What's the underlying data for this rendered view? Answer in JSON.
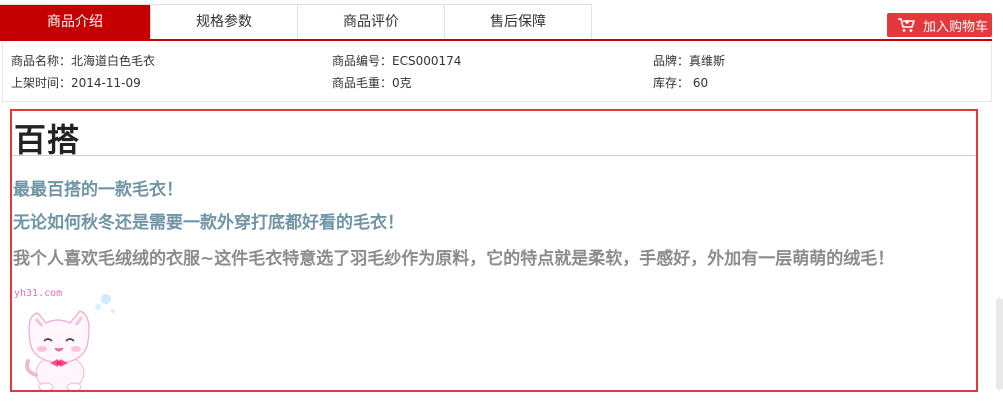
{
  "tabs": [
    {
      "label": "商品介绍",
      "active": true
    },
    {
      "label": "规格参数",
      "active": false
    },
    {
      "label": "商品评价",
      "active": false
    },
    {
      "label": "售后保障",
      "active": false
    }
  ],
  "cart_button": {
    "label": "加入购物车",
    "icon": "cart-icon"
  },
  "attributes": {
    "name": {
      "key": "商品名称：",
      "value": "北海道白色毛衣"
    },
    "sku": {
      "key": "商品编号：",
      "value": "ECS000174"
    },
    "brand": {
      "key": "品牌：",
      "value": "真维斯"
    },
    "date": {
      "key": "上架时间：",
      "value": "2014-11-09"
    },
    "weight": {
      "key": "商品毛重：",
      "value": "0克"
    },
    "stock": {
      "key": "库存：",
      "value": " 60"
    }
  },
  "description": {
    "title": "百搭",
    "line1": "最最百搭的一款毛衣！",
    "line2": "无论如何秋冬还是需要一款外穿打底都好看的毛衣！",
    "line3": "我个人喜欢毛绒绒的衣服~这件毛衣特意选了羽毛纱作为原料，它的特点就是柔软，手感好，外加有一层萌萌的绒毛！",
    "watermark": "yh31.com"
  },
  "colors": {
    "accent": "#c40000",
    "cart": "#e4393c",
    "highlight_border": "#e4393c",
    "text_blue": "#6f95a6"
  }
}
